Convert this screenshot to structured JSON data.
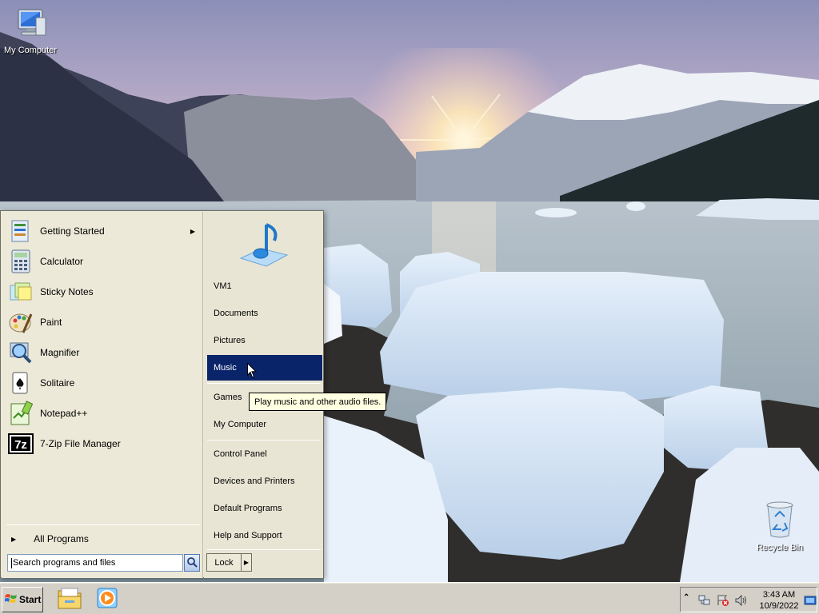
{
  "desktop": {
    "icons": [
      {
        "label": "My Computer"
      },
      {
        "label": "Recycle Bin"
      }
    ]
  },
  "start_menu": {
    "programs": [
      {
        "label": "Getting Started",
        "icon": "getting-started-icon",
        "has_submenu": true
      },
      {
        "label": "Calculator",
        "icon": "calculator-icon"
      },
      {
        "label": "Sticky Notes",
        "icon": "sticky-notes-icon"
      },
      {
        "label": "Paint",
        "icon": "paint-icon"
      },
      {
        "label": "Magnifier",
        "icon": "magnifier-icon"
      },
      {
        "label": "Solitaire",
        "icon": "solitaire-icon"
      },
      {
        "label": "Notepad++",
        "icon": "notepadpp-icon"
      },
      {
        "label": "7-Zip File Manager",
        "icon": "sevenzip-icon"
      }
    ],
    "all_programs": "All Programs",
    "search_placeholder": "Search programs and files",
    "places": [
      {
        "label": "VM1"
      },
      {
        "label": "Documents"
      },
      {
        "label": "Pictures"
      },
      {
        "label": "Music",
        "selected": true
      },
      {
        "label": "Games"
      },
      {
        "label": "My Computer"
      },
      {
        "label": "Control Panel"
      },
      {
        "label": "Devices and Printers"
      },
      {
        "label": "Default Programs"
      },
      {
        "label": "Help and Support"
      }
    ],
    "lock_label": "Lock",
    "tooltip": "Play music and other audio files."
  },
  "taskbar": {
    "start_label": "Start",
    "pinned": [
      {
        "icon": "windows-explorer-icon"
      },
      {
        "icon": "media-player-icon"
      }
    ],
    "clock_time": "3:43 AM",
    "clock_date": "10/9/2022"
  },
  "colors": {
    "selection": "#0a246a",
    "menu_bg": "#ece9d8",
    "taskbar_bg": "#d4d0c8",
    "tooltip_bg": "#ffffe1"
  }
}
